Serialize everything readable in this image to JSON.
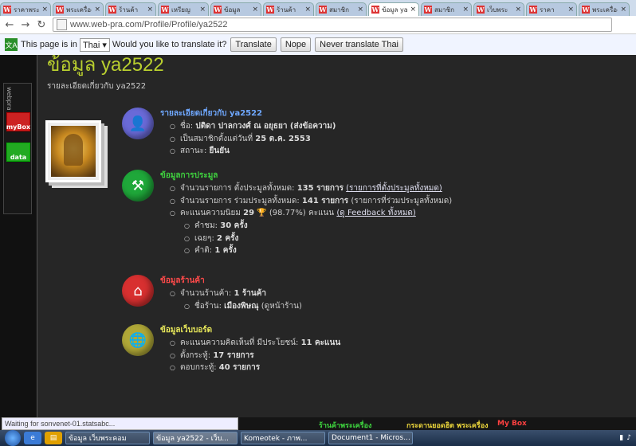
{
  "browser": {
    "tabs": [
      {
        "label": "ราคาพระ"
      },
      {
        "label": "พระเครื่อง"
      },
      {
        "label": "ร้านค้า"
      },
      {
        "label": "เหรียญ"
      },
      {
        "label": "ข้อมูล"
      },
      {
        "label": "ร้านค้า"
      },
      {
        "label": "สมาชิก"
      },
      {
        "label": "ข้อมูล ya"
      },
      {
        "label": "สมาชิก"
      },
      {
        "label": "เว็บพระ"
      },
      {
        "label": "ราคา"
      },
      {
        "label": "พระเครื่อง"
      }
    ],
    "tab_icon": "W",
    "tab_close": "×",
    "url": "www.web-pra.com/Profile/Profile/ya2522"
  },
  "translate_bar": {
    "prefix": "This page is in",
    "language": "Thai",
    "question": "Would you like to translate it?",
    "translate": "Translate",
    "nope": "Nope",
    "never": "Never translate Thai"
  },
  "sidebar": {
    "label": "webpra",
    "item1": "myBox",
    "item2": "data"
  },
  "profile": {
    "title": "ข้อมูล ya2522",
    "subtitle": "รายละเอียดเกี่ยวกับ ya2522"
  },
  "sections": {
    "about": {
      "heading": "รายละเอียดเกี่ยวกับ ya2522",
      "color": "#6fa8ff",
      "icon": "user-icon",
      "name_label": "ชื่อ:",
      "name_value": "ปติดา ปาลกวงศ์ ณ อยุธยา (ส่งข้อความ)",
      "since_label": "เป็นสมาชิกตั้งแต่วันที่",
      "since_value": "25 ต.ค. 2553",
      "status_label": "สถานะ:",
      "status_value": "ยืนยัน"
    },
    "auction": {
      "heading": "ข้อมูลการประมูล",
      "color": "#3fd13f",
      "icon": "gavel-icon",
      "total_items_label": "จำนวนรายการ ตั้งประมูลทั้งหมด:",
      "total_items_value": "135 รายการ",
      "total_items_link": "(รายการที่ตั้งประมูลทั้งหมด)",
      "joined_label": "จำนวนรายการ ร่วมประมูลทั้งหมด:",
      "joined_value": "141 รายการ",
      "joined_link": "(รายการที่ร่วมประมูลทั้งหมด)",
      "feedback_label": "คะแนนความนิยม",
      "feedback_value": "29",
      "feedback_pct": "(98.77%) คะแนน",
      "feedback_link": "(ดู Feedback ทั้งหมด)",
      "praise_label": "คำชม:",
      "praise_value": "30 ครั้ง",
      "neutral_label": "เฉยๆ:",
      "neutral_value": "2 ครั้ง",
      "complaint_label": "คำติ:",
      "complaint_value": "1 ครั้ง"
    },
    "shop": {
      "heading": "ข้อมูลร้านค้า",
      "color": "#ff4a4a",
      "icon": "home-icon",
      "count_label": "จำนวนร้านค้า:",
      "count_value": "1 ร้านค้า",
      "name_label": "ชื่อร้าน:",
      "name_value": "เมืองพิษณุ",
      "name_link": "(ดูหน้าร้าน)"
    },
    "board": {
      "heading": "ข้อมูลเว็บบอร์ด",
      "color": "#e8e85a",
      "icon": "globe-icon",
      "score_label": "คะแนนความคิดเห็นที่ มีประโยชน์:",
      "score_value": "11 คะแนน",
      "threads_label": "ตั้งกระทู้:",
      "threads_value": "17 รายการ",
      "replies_label": "ตอบกระทู้:",
      "replies_value": "40 รายการ"
    }
  },
  "footer": {
    "status": "Waiting for sonvenet-01.statsabc...",
    "link1": "ร้านค้าพระเครื่อง",
    "link2": "กระดานยอดฮิต พระเครื่อง",
    "link3": "My Box"
  },
  "taskbar": {
    "tasks": [
      {
        "label": "ข้อมูล เว็บพระคอม"
      },
      {
        "label": "ข้อมูล ya2522 - เว็บ..."
      },
      {
        "label": "Komeotek - ภาพ..."
      },
      {
        "label": "Document1 - Micros..."
      }
    ]
  }
}
